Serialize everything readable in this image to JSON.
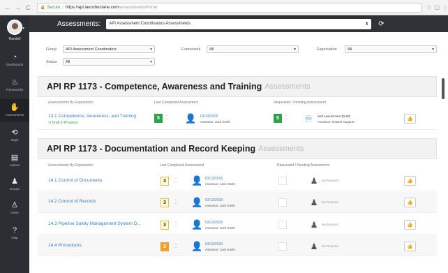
{
  "browser": {
    "secure": "Secure",
    "url_host": "https://api.launchoctane.com",
    "url_path": "/assessments#home",
    "back": "←",
    "forward": "→",
    "reload": "C"
  },
  "sidebar": {
    "user_name": "Randell",
    "items": [
      {
        "label": "Dashboards",
        "icon": "◔"
      },
      {
        "label": "Frameworks",
        "icon": "♨"
      },
      {
        "label": "Assessments",
        "icon": "✋"
      },
      {
        "label": "Gaps",
        "icon": "⟲"
      },
      {
        "label": "Actions",
        "icon": "▤"
      },
      {
        "label": "Groups",
        "icon": "♟"
      },
      {
        "label": "Users",
        "icon": "♙"
      },
      {
        "label": "Help",
        "icon": "?"
      }
    ]
  },
  "header": {
    "title": "Assessments:",
    "selected": "API Assessment Coordinators Assessments"
  },
  "filters": {
    "group_label": "Group",
    "group_value": "API Assessment Coordinators",
    "framework_label": "Framework",
    "framework_value": "All",
    "expectation_label": "Expectation",
    "expectation_value": "All",
    "status_label": "Status",
    "status_value": "All"
  },
  "sections": [
    {
      "title": "API RP 1173 - Competence, Awareness and Training",
      "sub": "Assessments",
      "col_expectation": "Assessments By Expectation",
      "col_last": "Last Completed Assessment",
      "col_pending": "Requested / Pending Assessment",
      "rows": [
        {
          "link": "13.1 Competence, Awareness, and Training",
          "draft": "Draft in Progress",
          "score": "5",
          "date": "03/13/2018",
          "assessor": "Assessor: Jack Smith",
          "req_score": "5",
          "req_type": "Self Assessment (Draft)",
          "req_assessor": "Assessor: Octane Support"
        }
      ]
    },
    {
      "title": "API RP 1173 - Documentation and Record Keeping",
      "sub": "Assessments",
      "col_expectation": "Assessments By Expectation",
      "col_last": "Last Completed Assessment",
      "col_pending": "Requested / Pending Assessment",
      "rows": [
        {
          "link": "14.1 Control of Documents",
          "score": "3",
          "date": "03/13/2018",
          "assessor": "Assessor: Jack Smith",
          "req": "No Request"
        },
        {
          "link": "14.2 Control of Records",
          "score": "3",
          "date": "03/13/2018",
          "assessor": "Assessor: Jack Smith",
          "req": "No Request"
        },
        {
          "link": "14.3 Pipeline Safety Management System D...",
          "score": "3",
          "date": "03/13/2018",
          "assessor": "Assessor: Jack Smith",
          "req": "No Request"
        },
        {
          "link": "14.4 Procedures",
          "score": "2",
          "date": "03/13/2018",
          "assessor": "Assessor: Jack Smith",
          "req": "No Request"
        }
      ]
    }
  ]
}
